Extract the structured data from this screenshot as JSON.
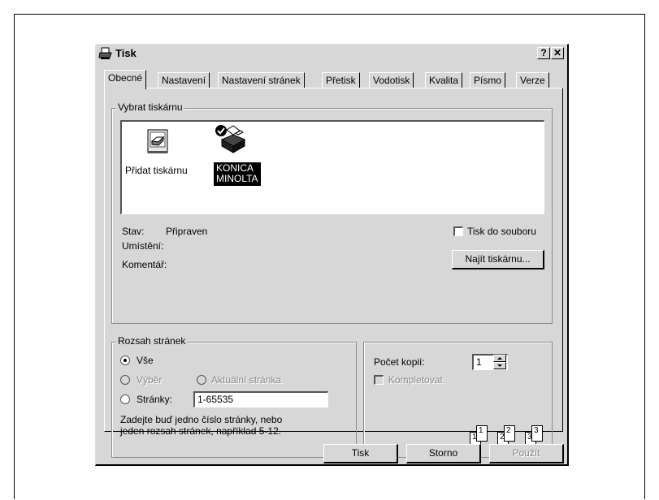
{
  "dialog": {
    "title": "Tisk",
    "help_button": "?",
    "close_button": "✕"
  },
  "tabs": [
    {
      "label": "Obecné",
      "active": true
    },
    {
      "label": "Nastavení"
    },
    {
      "label": "Nastavení stránek"
    },
    {
      "label": "Přetisk"
    },
    {
      "label": "Vodotisk"
    },
    {
      "label": "Kvalita"
    },
    {
      "label": "Písmo"
    },
    {
      "label": "Verze"
    }
  ],
  "printer_group": {
    "legend": "Vybrat tiskárnu",
    "items": [
      {
        "label": "Přidat tiskárnu",
        "icon": "add-printer-icon"
      },
      {
        "label_line1": "KONICA",
        "label_line2": "MINOLTA",
        "icon": "printer-icon",
        "selected": true
      }
    ],
    "status_label": "Stav:",
    "status_value": "Připraven",
    "location_label": "Umístění:",
    "comment_label": "Komentář:",
    "print_to_file": "Tisk do souboru",
    "find_printer": "Najít tiskárnu..."
  },
  "range_group": {
    "legend": "Rozsah stránek",
    "all": "Vše",
    "selection": "Výběr",
    "current_page": "Aktuální stránka",
    "pages": "Stránky:",
    "pages_value": "1-65535",
    "hint_line1": "Zadejte buď jedno číslo stránky, nebo",
    "hint_line2": "jeden rozsah stránek, například 5-12."
  },
  "copies_group": {
    "copies_label": "Počet kopií:",
    "copies_value": "1",
    "collate": "Kompletovat",
    "collate_pages": [
      "1",
      "1",
      "2",
      "2",
      "3",
      "3"
    ]
  },
  "buttons": {
    "print": "Tisk",
    "cancel": "Storno",
    "apply": "Použít"
  }
}
